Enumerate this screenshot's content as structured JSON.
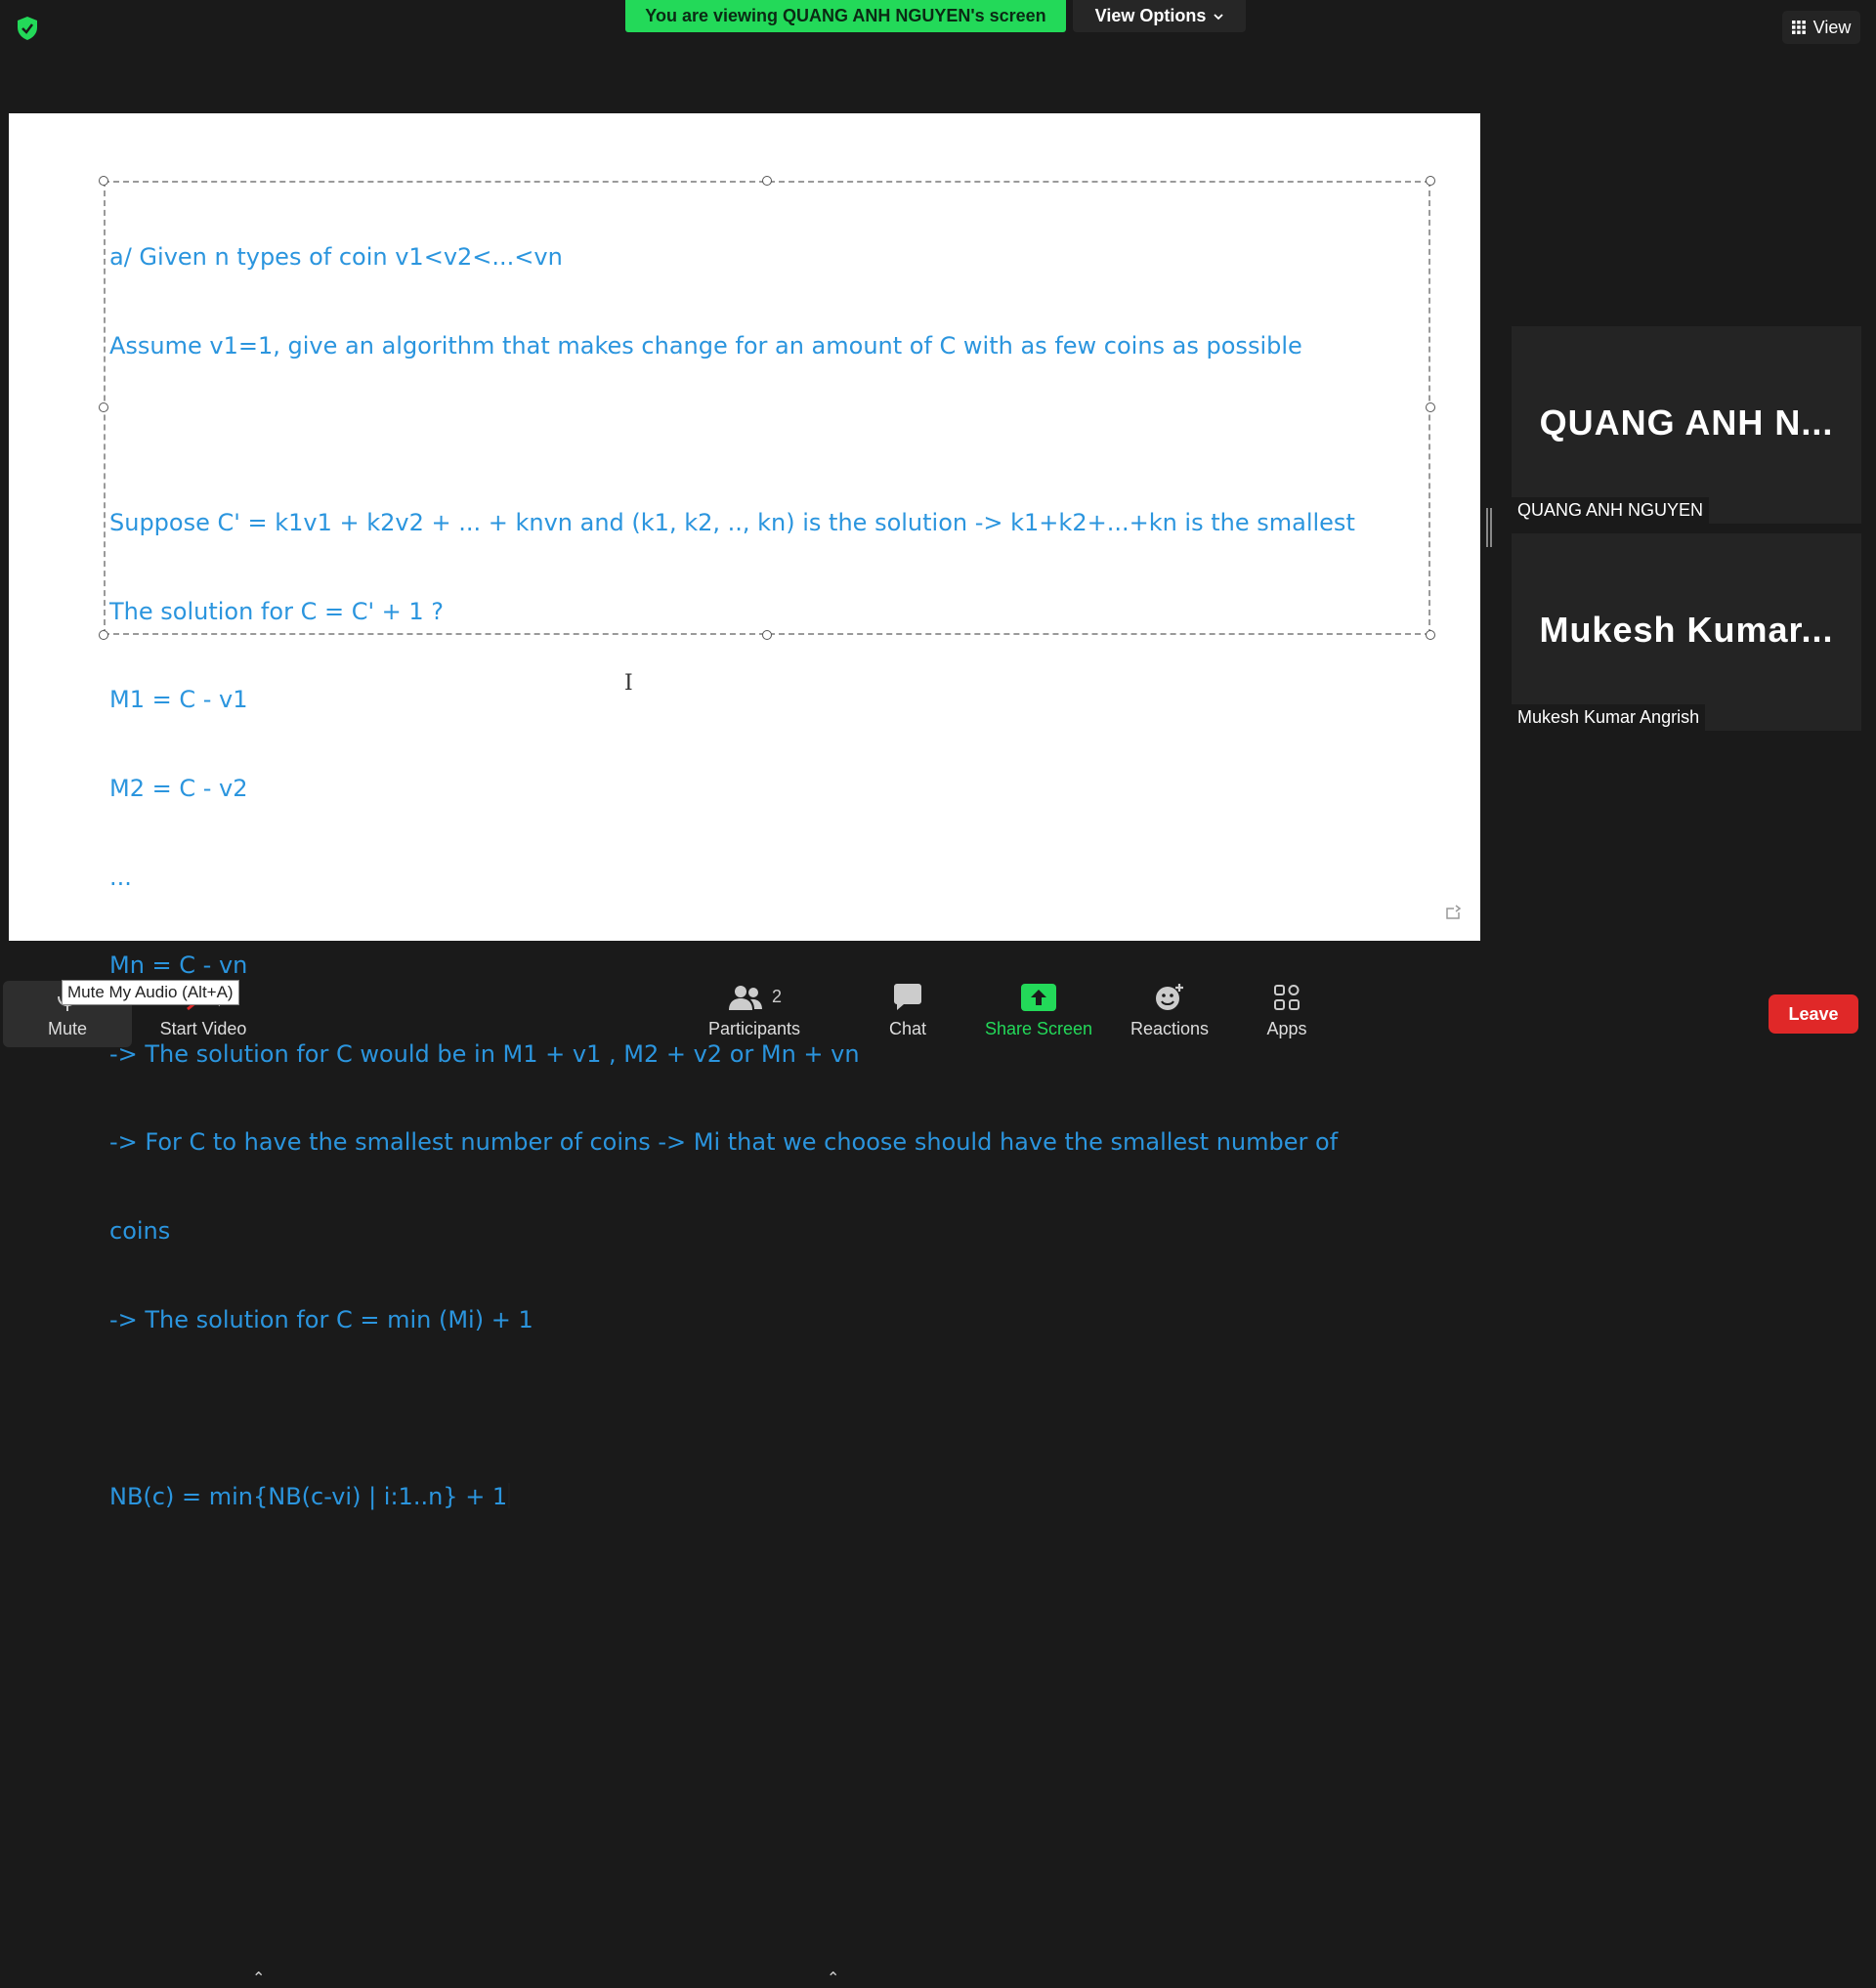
{
  "top_bar": {
    "banner_text": "You are viewing QUANG ANH NGUYEN's screen",
    "view_options_label": "View Options",
    "view_label": "View"
  },
  "shared_screen": {
    "lines": [
      "a/ Given n types of coin v1<v2<...<vn",
      "Assume v1=1, give an algorithm that makes change for an amount of C with as few coins as possible",
      "",
      "Suppose C' = k1v1 + k2v2 + ... + knvn and (k1, k2, .., kn) is the solution -> k1+k2+...+kn is the smallest",
      "The solution for C = C' + 1 ?",
      "M1 = C - v1",
      "M2 = C - v2",
      "...",
      "Mn = C - vn",
      "-> The solution for C would be in M1 + v1 , M2 + v2 or Mn + vn",
      "-> For C to have the smallest number of coins -> Mi that we choose should have the smallest number of",
      "coins",
      "-> The solution for C = min (Mi) + 1",
      "",
      "NB(c) = min{NB(c-vi) | i:1..n} + 1"
    ],
    "text_color": "#2b95de"
  },
  "participants": [
    {
      "tile_name": "QUANG ANH N...",
      "label": "QUANG ANH NGUYEN"
    },
    {
      "tile_name": "Mukesh Kumar...",
      "label": "Mukesh Kumar Angrish"
    }
  ],
  "toolbar": {
    "mute_label": "Mute",
    "mute_tooltip": "Mute My Audio (Alt+A)",
    "start_video_label": "Start Video",
    "participants_label": "Participants",
    "participants_count": "2",
    "chat_label": "Chat",
    "share_screen_label": "Share Screen",
    "reactions_label": "Reactions",
    "apps_label": "Apps",
    "leave_label": "Leave"
  },
  "colors": {
    "banner_green": "#23d959",
    "share_green": "#23d959",
    "leave_red": "#e02828"
  }
}
